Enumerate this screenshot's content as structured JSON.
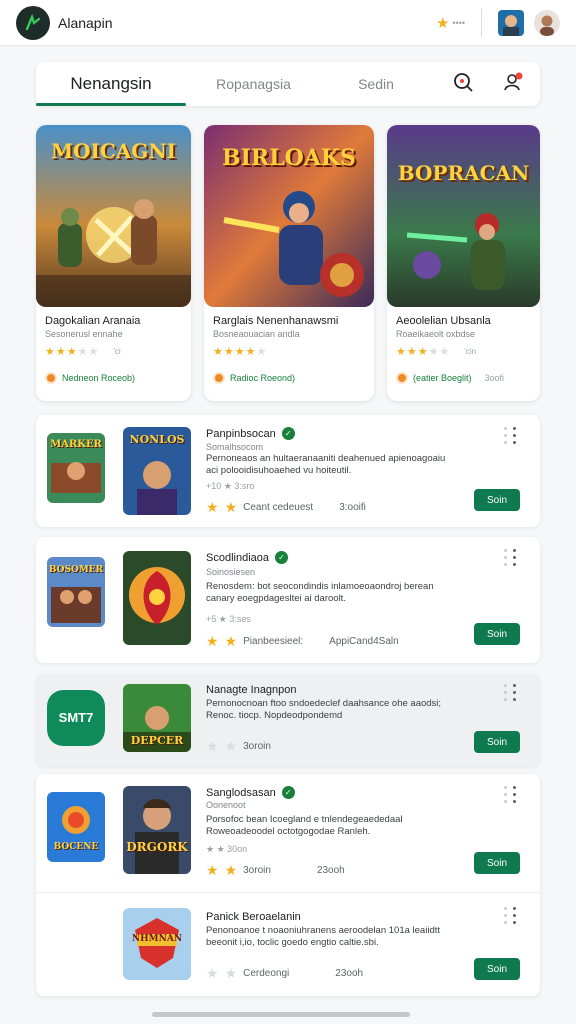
{
  "app": {
    "title": "Alanapin",
    "coin_text": "••••"
  },
  "tabs": [
    {
      "label": "Nenangsin",
      "active": true
    },
    {
      "label": "Ropanagsia",
      "active": false
    },
    {
      "label": "Sedin",
      "active": false
    }
  ],
  "tab_icons": [
    "search-icon",
    "profile-notification-icon"
  ],
  "colors": {
    "accent": "#0f7a4f",
    "star": "#f2b01e",
    "badge": "#f08a24"
  },
  "featured": [
    {
      "art_title": "MOICAGNI",
      "title": "Dagokalian Aranaia",
      "subtitle": "Sesonerusl ennahe",
      "rating": 3.5,
      "rating_text": "'ci",
      "badge": "Nedneon Roceob)",
      "count": ""
    },
    {
      "art_title": "BIRLOAKS",
      "title": "Rarglais Nenenhanawsmi",
      "subtitle": "Bosneaouacian andla",
      "rating": 4,
      "rating_text": "",
      "badge": "Radioc Roeond)",
      "count": ""
    },
    {
      "art_title": "BOPRACAN",
      "title": "Aeoolelian Ubsanla",
      "subtitle": "Roaeikaeolt oxbdse",
      "rating": 3,
      "rating_text": "'cin",
      "badge": "(eatier Boeglit)",
      "count": "3oofi"
    }
  ],
  "list": [
    {
      "title": "Panpinbsocan",
      "verified": true,
      "subtitle": "Somalhsocom",
      "desc": "Pernoneaos an hultaeranaaniti deahenued apienoagoaiu aci polooidisuhoaehed vu hoiteutil.",
      "meta": "+10 ★ 3:sro",
      "footer": "Ceant cedeuest",
      "extra": "3:ooifi",
      "button": "Soin",
      "small_art": "MARKER",
      "main_art": "NONLOS"
    },
    {
      "title": "Scodlindiaoa",
      "verified": true,
      "subtitle": "Soinosiesen",
      "desc": "Renosdem: bot seocondindis inlamoeoaondroj berean canary eoegpdagesltei ai daroolt.",
      "meta": "+5 ★ 3:ses",
      "footer": "Pianbeesieel:",
      "extra": "AppiCand4Saln",
      "button": "Soin",
      "small_art": "BOSOMER",
      "main_art": ""
    },
    {
      "title": "Nanagte Inagnpon",
      "verified": false,
      "subtitle": "",
      "desc": "Pernonocnoan ftoo sndoedeclef daahsance ohe aaodsi; Renoc. tiocp.  Nopdeodpondemd",
      "meta": "",
      "footer": "3oroin",
      "extra": "",
      "button": "Soin",
      "small_art": "SMT7",
      "main_art": "DEPCER"
    },
    {
      "title": "Sanglodsasan",
      "verified": true,
      "subtitle": "Oonenoot",
      "desc": "Porsofoc bean Icoegland e tnlendegeaededaal Roweoadeoodel octotgogodae Ranleh.",
      "meta": "★ ★ 30on",
      "footer": "3oroin",
      "extra": "23ooh",
      "button": "Soin",
      "small_art": "BOCENE",
      "main_art": "DRGORK"
    },
    {
      "title": "Panick Beroaelanin",
      "verified": false,
      "subtitle": "",
      "desc": "Penonoanoe t noaoniuhranens aeroodelan 101a leaiidtt beeonit i,io, toclic goedo engtio caltie.sbi.",
      "meta": "",
      "footer": "Cerdeongi",
      "extra": "23ooh",
      "button": "Soin",
      "small_art": "",
      "main_art": "NHMNAN"
    }
  ]
}
